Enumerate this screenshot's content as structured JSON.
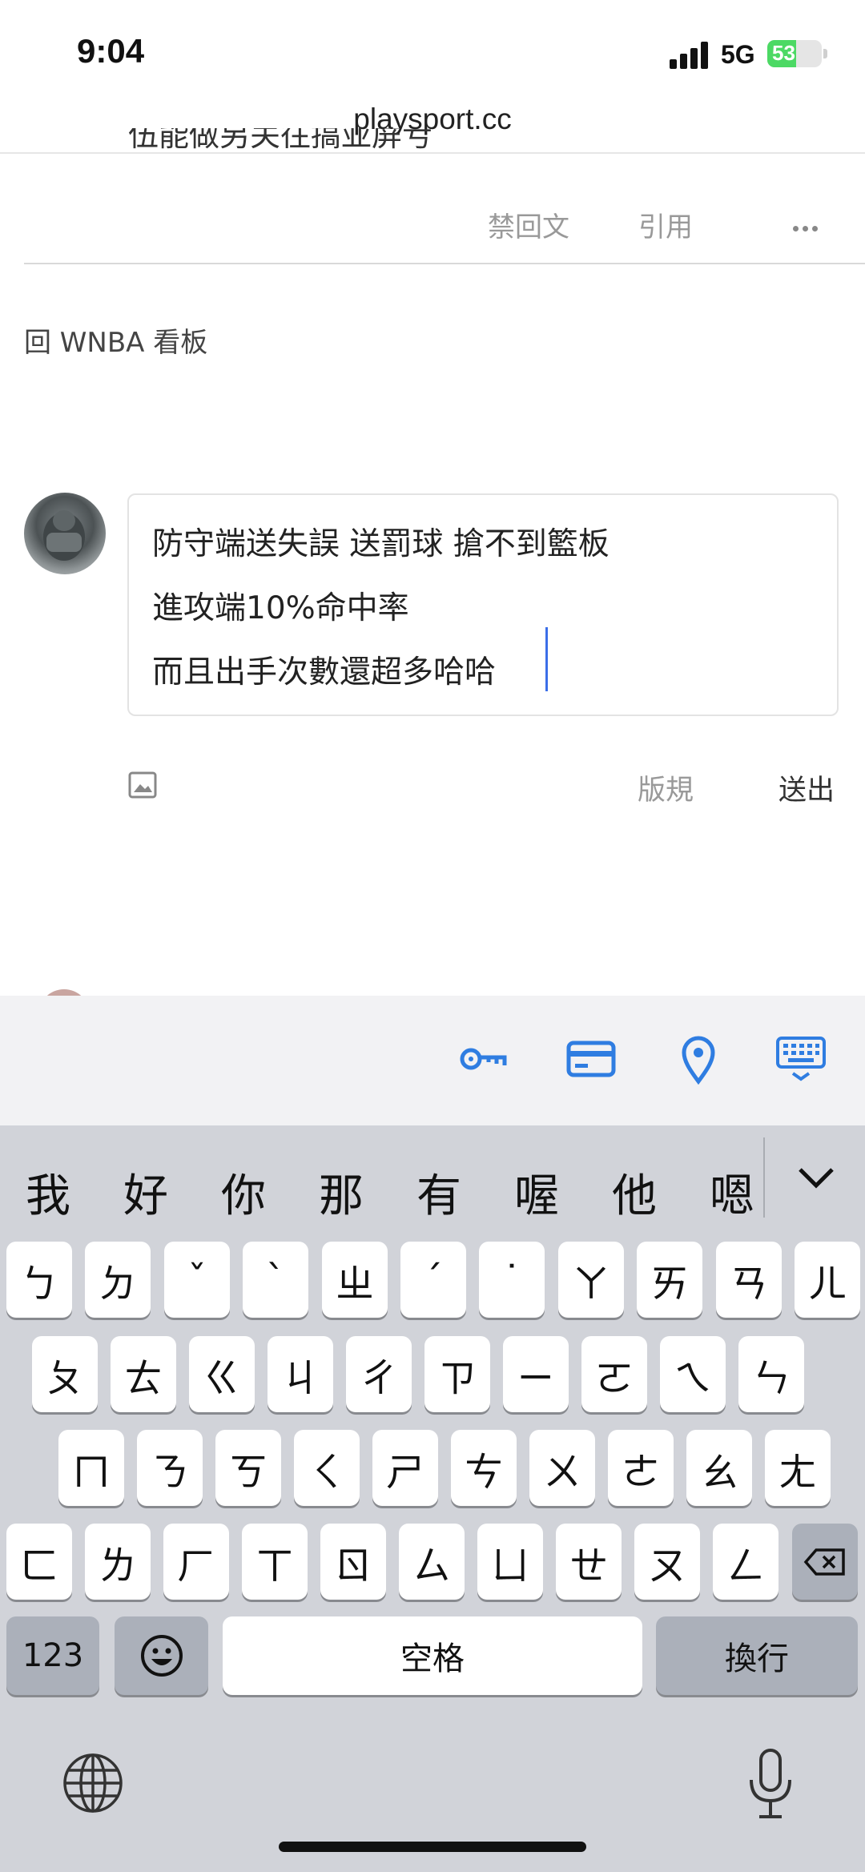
{
  "status_bar": {
    "time": "9:04",
    "network": "5G",
    "battery": "53",
    "battery_level_pct": 53
  },
  "browser": {
    "url": "playsport.cc"
  },
  "previous_post": {
    "cut_text": "伍能做另关往搞亚屏亏",
    "actions": {
      "no_reply": "禁回文",
      "quote": "引用"
    }
  },
  "back_link": "回 WNBA 看板",
  "composer": {
    "lines": [
      "防守端送失誤 送罰球 搶不到籃板",
      "進攻端10%命中率",
      "而且出手次數還超多哈哈"
    ],
    "rules_label": "版規",
    "send_label": "送出"
  },
  "autofill_bar": {
    "icons": [
      "key-icon",
      "credit-card-icon",
      "location-pin-icon",
      "keyboard-icon"
    ],
    "accent": "#2f7de1"
  },
  "keyboard": {
    "candidates": [
      "我",
      "好",
      "你",
      "那",
      "有",
      "喔",
      "他",
      "嗯"
    ],
    "rows": [
      [
        "ㄅ",
        "ㄉ",
        "ˇ",
        "ˋ",
        "ㄓ",
        "ˊ",
        "˙",
        "ㄚ",
        "ㄞ",
        "ㄢ",
        "ㄦ"
      ],
      [
        "ㄆ",
        "ㄊ",
        "ㄍ",
        "ㄐ",
        "ㄔ",
        "ㄗ",
        "ㄧ",
        "ㄛ",
        "ㄟ",
        "ㄣ"
      ],
      [
        "ㄇ",
        "ㄋ",
        "ㄎ",
        "ㄑ",
        "ㄕ",
        "ㄘ",
        "ㄨ",
        "ㄜ",
        "ㄠ",
        "ㄤ"
      ],
      [
        "ㄈ",
        "ㄌ",
        "ㄏ",
        "ㄒ",
        "ㄖ",
        "ㄙ",
        "ㄩ",
        "ㄝ",
        "ㄡ",
        "ㄥ"
      ]
    ],
    "numbers_label": "123",
    "space_label": "空格",
    "return_label": "換行"
  }
}
